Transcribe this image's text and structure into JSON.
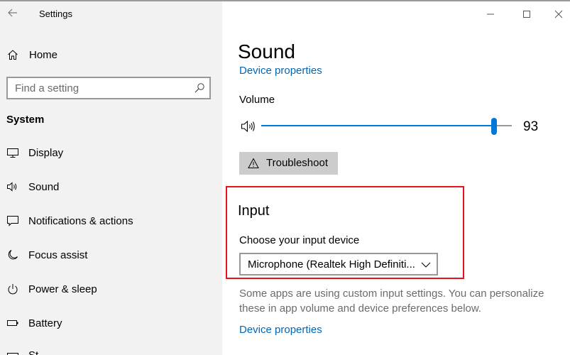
{
  "window": {
    "app_title": "Settings"
  },
  "sidebar": {
    "home_label": "Home",
    "search_placeholder": "Find a setting",
    "section_label": "System",
    "items": [
      {
        "label": "Display",
        "icon": "display-icon"
      },
      {
        "label": "Sound",
        "icon": "speaker-icon"
      },
      {
        "label": "Notifications & actions",
        "icon": "notifications-icon"
      },
      {
        "label": "Focus assist",
        "icon": "moon-icon"
      },
      {
        "label": "Power & sleep",
        "icon": "power-icon"
      },
      {
        "label": "Battery",
        "icon": "battery-icon"
      },
      {
        "label": "St",
        "icon": "storage-icon"
      }
    ]
  },
  "main": {
    "page_title": "Sound",
    "top_link": "Device properties",
    "volume_label": "Volume",
    "volume_value": 93,
    "troubleshoot_label": "Troubleshoot",
    "input_heading": "Input",
    "choose_input_label": "Choose your input device",
    "input_device_value": "Microphone (Realtek High Definiti...",
    "description": "Some apps are using custom input settings. You can personalize these in app volume and device preferences below.",
    "bottom_link": "Device properties"
  },
  "colors": {
    "accent": "#0078d7",
    "link": "#0067b8",
    "highlight_border": "#e3141c",
    "sidebar_bg": "#f2f2f2"
  }
}
